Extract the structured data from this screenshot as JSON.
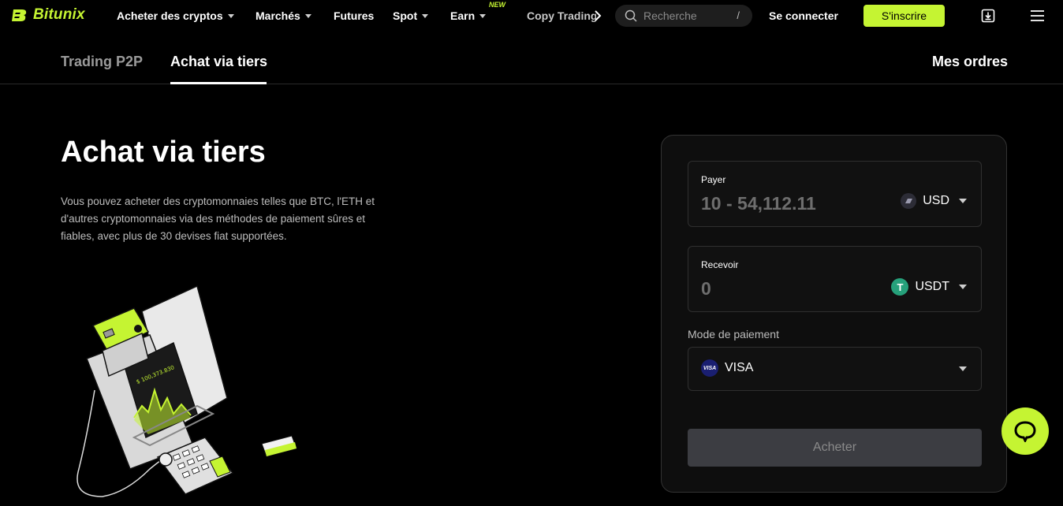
{
  "nav": {
    "brand": "Bitunix",
    "items": [
      {
        "label": "Acheter des cryptos",
        "dropdown": true
      },
      {
        "label": "Marchés",
        "dropdown": true
      },
      {
        "label": "Futures",
        "dropdown": false
      },
      {
        "label": "Spot",
        "dropdown": true
      },
      {
        "label": "Earn",
        "dropdown": true
      }
    ],
    "new_badge": "NEW",
    "copy_trading": "Copy Trading",
    "search_placeholder": "Recherche",
    "search_shortcut": "/",
    "login": "Se connecter",
    "signup": "S'inscrire"
  },
  "tabs": {
    "p2p": "Trading P2P",
    "third_party": "Achat via tiers",
    "orders": "Mes ordres"
  },
  "hero": {
    "title": "Achat via tiers",
    "description": "Vous pouvez acheter des cryptomonnaies telles que BTC, l'ETH et d'autres cryptomonnaies via des méthodes de paiement sûres et fiables, avec plus de 30 devises fiat supportées.",
    "illustration_amount": "$ 100,373.830"
  },
  "form": {
    "pay_label": "Payer",
    "pay_value": "10 - 54,112.11",
    "pay_currency": "USD",
    "receive_label": "Recevoir",
    "receive_value": "0",
    "receive_currency": "USDT",
    "receive_currency_symbol": "T",
    "payment_method_label": "Mode de paiement",
    "payment_method": "VISA",
    "payment_method_icon_text": "VISA",
    "buy_label": "Acheter"
  },
  "colors": {
    "accent": "#c5f432",
    "background": "#000000",
    "panel": "#0e0e0e",
    "disabled_button": "#3c3d42",
    "usdt": "#26a17b",
    "visa": "#1a1f71"
  }
}
